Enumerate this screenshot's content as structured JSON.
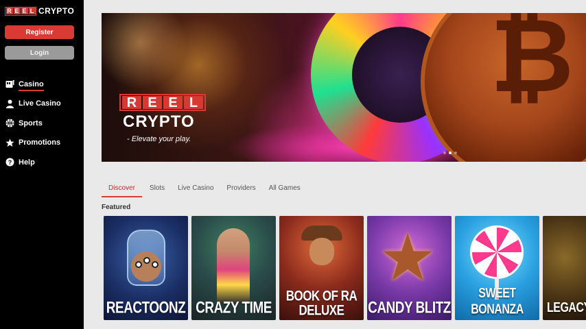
{
  "brand": {
    "reel_letters": [
      "R",
      "E",
      "E",
      "L"
    ],
    "crypto": "CRYPTO"
  },
  "auth": {
    "register_label": "Register",
    "login_label": "Login"
  },
  "nav": {
    "items": [
      {
        "label": "Casino",
        "icon": "slot-machine-icon",
        "active": true
      },
      {
        "label": "Live Casino",
        "icon": "dealer-icon",
        "active": false
      },
      {
        "label": "Sports",
        "icon": "basketball-icon",
        "active": false
      },
      {
        "label": "Promotions",
        "icon": "star-icon",
        "active": false
      },
      {
        "label": "Help",
        "icon": "help-icon",
        "active": false
      }
    ]
  },
  "banner": {
    "logo_reel_letters": [
      "R",
      "E",
      "E",
      "L"
    ],
    "logo_crypto": "CRYPTO",
    "tagline": "- Elevate your play.",
    "slide_count": 3,
    "active_slide": 1
  },
  "tabs": [
    {
      "label": "Discover",
      "active": true
    },
    {
      "label": "Slots",
      "active": false
    },
    {
      "label": "Live Casino",
      "active": false
    },
    {
      "label": "Providers",
      "active": false
    },
    {
      "label": "All Games",
      "active": false
    }
  ],
  "featured": {
    "title": "Featured",
    "games": [
      {
        "title": "REACTOONZ"
      },
      {
        "title": "CRAZY TIME"
      },
      {
        "title": "BOOK OF RA\nDELUXE"
      },
      {
        "title": "CANDY BLITZ"
      },
      {
        "title": "SWEET BONANZA"
      },
      {
        "title": "LEGACY O"
      }
    ]
  },
  "colors": {
    "accent": "#d93a33",
    "sidebar_bg": "#000000",
    "page_bg": "#e9e9e9",
    "login_bg": "#9a9a9a"
  }
}
